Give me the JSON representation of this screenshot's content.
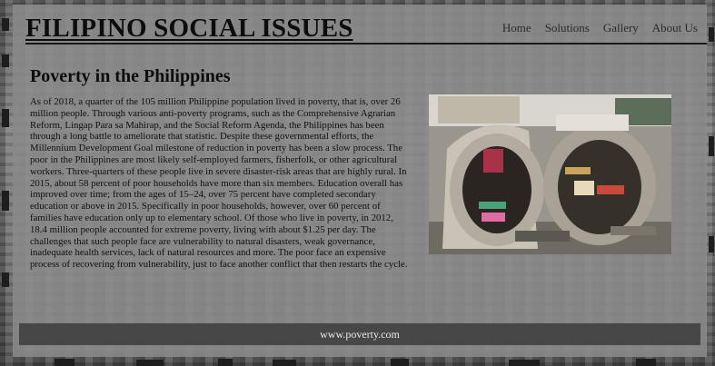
{
  "header": {
    "site_title": "FILIPINO SOCIAL ISSUES",
    "nav": [
      {
        "label": "Home"
      },
      {
        "label": "Solutions"
      },
      {
        "label": "Gallery"
      },
      {
        "label": "About Us"
      }
    ]
  },
  "main": {
    "title": "Poverty in the Philippines",
    "paragraph": "As of 2018, a quarter of the 105 million Philippine population lived in poverty, that is, over 26 million people. Through various anti-poverty programs, such as the Comprehensive Agrarian Reform, Lingap Para sa Mahirap, and the Social Reform Agenda, the Philippines has been through a long battle to ameliorate that statistic. Despite these governmental efforts, the Millennium Development Goal milestone of reduction in poverty has been a slow process. The poor in the Philippines are most likely self-employed farmers, fisherfolk, or other agricultural workers. Three-quarters of these people live in severe disaster-risk areas that are highly rural. In 2015, about 58 percent of poor households have more than six members. Education overall has improved over time; from the ages of 15–24, over 75 percent have completed secondary education or above in 2015. Specifically in poor households, however, over 60 percent of families have education only up to elementary school. Of those who live in poverty, in 2012, 18.4 million people accounted for extreme poverty, living with about $1.25 per day. The challenges that such people face are vulnerability to natural disasters, weak governance, inadequate health services, lack of natural resources and more. The poor face an expensive process of recovering from vulnerability, just to face another conflict that then restarts the cycle."
  },
  "footer": {
    "text": "www.poverty.com"
  }
}
